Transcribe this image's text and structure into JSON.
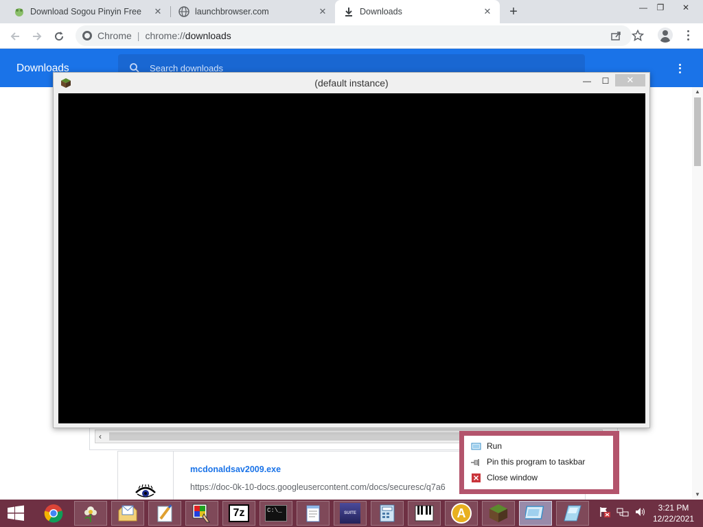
{
  "browser": {
    "tabs": [
      {
        "title": "Download Sogou Pinyin Free",
        "icon": "sogou-icon"
      },
      {
        "title": "launchbrowser.com",
        "icon": "globe-icon"
      },
      {
        "title": "Downloads",
        "icon": "download-icon",
        "active": true
      }
    ],
    "new_tab": "+",
    "window_controls": {
      "minimize": "—",
      "restore": "❐",
      "close": "✕"
    },
    "omnibox": {
      "origin": "Chrome",
      "separator": "|",
      "scheme": "chrome://",
      "path": "downloads"
    }
  },
  "downloads_page": {
    "title": "Downloads",
    "search_placeholder": "Search downloads",
    "items": [
      {
        "filename": "mcdonaldsav2009.exe",
        "url": "https://doc-0k-10-docs.googleusercontent.com/docs/securesc/q7a6"
      }
    ]
  },
  "app_window": {
    "title": "(default instance)",
    "minimize": "—",
    "maximize": "☐",
    "close": "✕"
  },
  "jump_list": {
    "items": [
      {
        "label": "Run",
        "icon": "run-icon"
      },
      {
        "label": "Pin this program to taskbar",
        "icon": "pin-icon"
      },
      {
        "label": "Close window",
        "icon": "close-window-icon"
      }
    ]
  },
  "taskbar": {
    "apps": [
      "start-button",
      "chrome-icon",
      "flower-app-icon",
      "mail-folder-icon",
      "paint-icon",
      "color-picker-icon",
      "7zip-icon",
      "cmd-icon",
      "notepad-icon",
      "suite-app-icon",
      "calculator-icon",
      "piano-icon",
      "letter-a-icon",
      "minecraft-icon",
      "active-window-icon",
      "glass-app-icon"
    ],
    "labels": {
      "seven_zip": "7z",
      "cmd": "C:\\_",
      "letter_a": "A",
      "suite": "SUITE"
    },
    "clock": {
      "time": "3:21 PM",
      "date": "12/22/2021"
    }
  }
}
